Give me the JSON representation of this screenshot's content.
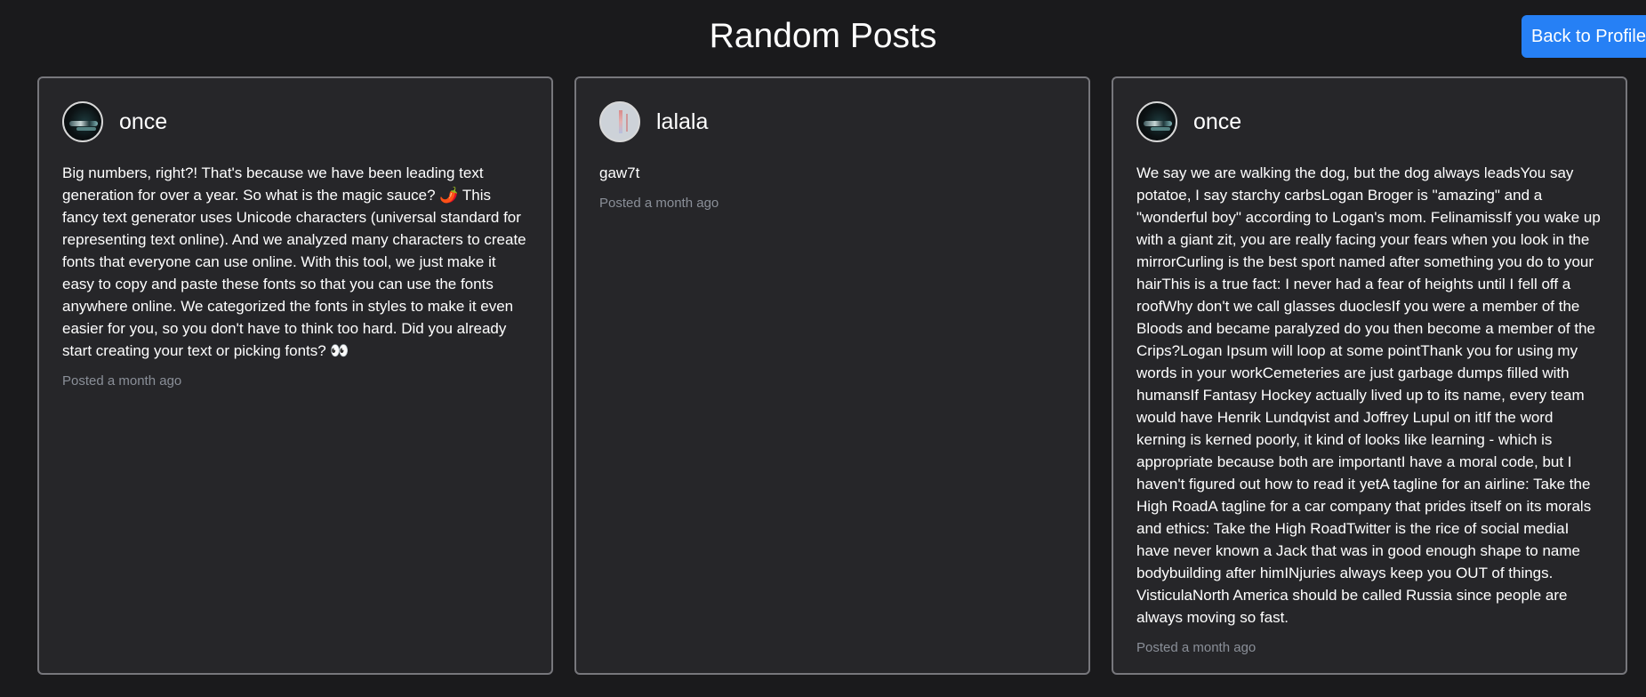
{
  "header": {
    "title": "Random Posts",
    "back_label": "Back to Profile"
  },
  "posts": [
    {
      "username": "once",
      "avatar": "dark-photo-avatar",
      "content": "Big numbers, right?! That's because we have been leading text generation for over a year. So what is the magic sauce? 🌶️ This fancy text generator uses Unicode characters (universal standard for representing text online). And we analyzed many characters to create fonts that everyone can use online. With this tool, we just make it easy to copy and paste these fonts so that you can use the fonts anywhere online. We categorized the fonts in styles to make it even easier for you, so you don't have to think too hard. Did you already start creating your text or picking fonts? 👀",
      "timestamp": "Posted a month ago"
    },
    {
      "username": "lalala",
      "avatar": "light-photo-avatar",
      "content": "gaw7t",
      "timestamp": "Posted a month ago"
    },
    {
      "username": "once",
      "avatar": "dark-photo-avatar",
      "content": "We say we are walking the dog, but the dog always leadsYou say potatoe, I say starchy carbsLogan Broger is \"amazing\" and a \"wonderful boy\" according to Logan's mom. FelinamissIf you wake up with a giant zit, you are really facing your fears when you look in the mirrorCurling is the best sport named after something you do to your hairThis is a true fact: I never had a fear of heights until I fell off a roofWhy don't we call glasses duoclesIf you were a member of the Bloods and became paralyzed do you then become a member of the Crips?Logan Ipsum will loop at some pointThank you for using my words in your workCemeteries are just garbage dumps filled with humansIf Fantasy Hockey actually lived up to its name, every team would have Henrik Lundqvist and Joffrey Lupul on itIf the word kerning is kerned poorly, it kind of looks like learning - which is appropriate because both are importantI have a moral code, but I haven't figured out how to read it yetA tagline for an airline: Take the High RoadA tagline for a car company that prides itself on its morals and ethics: Take the High RoadTwitter is the rice of social mediaI have never known a Jack that was in good enough shape to name bodybuilding after himINjuries always keep you OUT of things. VisticulaNorth America should be called Russia since people are always moving so fast.",
      "timestamp": "Posted a month ago"
    }
  ]
}
